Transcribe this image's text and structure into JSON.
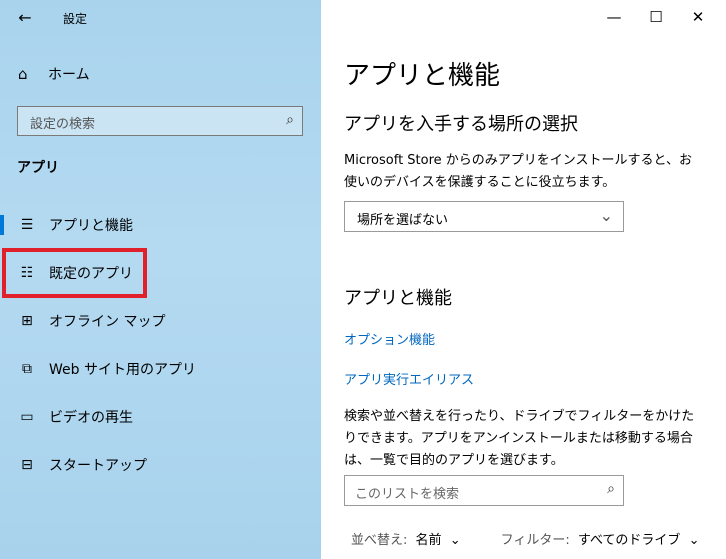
{
  "window": {
    "title": "設定"
  },
  "sidebar": {
    "home_label": "ホーム",
    "search_placeholder": "設定の検索",
    "section_label": "アプリ",
    "items": [
      {
        "label": "アプリと機能",
        "icon": "list-icon"
      },
      {
        "label": "既定のアプリ",
        "icon": "default-apps-icon"
      },
      {
        "label": "オフライン マップ",
        "icon": "map-icon"
      },
      {
        "label": "Web サイト用のアプリ",
        "icon": "web-apps-icon"
      },
      {
        "label": "ビデオの再生",
        "icon": "video-icon"
      },
      {
        "label": "スタートアップ",
        "icon": "startup-icon"
      }
    ]
  },
  "main": {
    "title": "アプリと機能",
    "install_section": {
      "heading": "アプリを入手する場所の選択",
      "description": "Microsoft Store からのみアプリをインストールすると、お使いのデバイスを保護することに役立ちます。",
      "dropdown_value": "場所を選ばない"
    },
    "features_section": {
      "heading": "アプリと機能",
      "link_optional": "オプション機能",
      "link_aliases": "アプリ実行エイリアス",
      "description": "検索や並べ替えを行ったり、ドライブでフィルターをかけたりできます。アプリをアンインストールまたは移動する場合は、一覧で目的のアプリを選びます。",
      "search_placeholder": "このリストを検索",
      "sort_label": "並べ替え:",
      "sort_value": "名前",
      "filter_label": "フィルター:",
      "filter_value": "すべてのドライブ"
    }
  },
  "colors": {
    "accent": "#0078d7",
    "link": "#0067c0",
    "highlight": "#e0202a"
  }
}
